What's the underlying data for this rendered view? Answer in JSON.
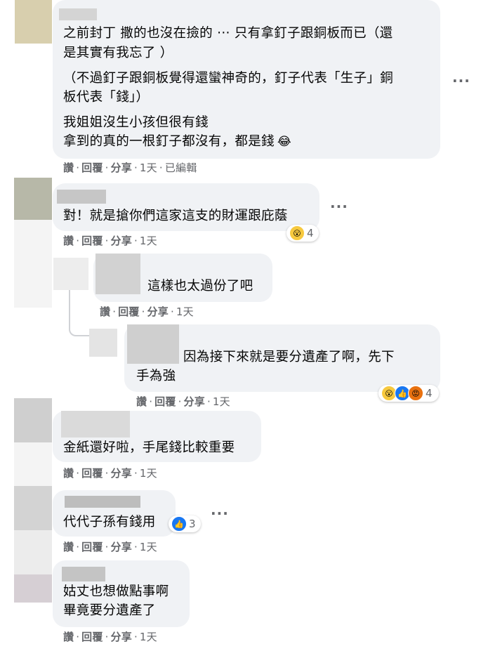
{
  "comments": [
    {
      "lines": [
        "之前封丁 撒的也沒在撿的 ··· 只有拿釘子跟銅板而已（還",
        "是其實有我忘了 ）",
        "（不過釘子跟銅板覺得還蠻神奇的，釘子代表「生子」銅",
        "板代表「錢」）",
        "我姐姐沒生小孩但很有錢",
        "拿到的真的一根釘子都沒有，都是錢"
      ],
      "emoji": "😂",
      "actions": {
        "like": "讚",
        "reply": "回覆",
        "share": "分享",
        "time": "1天",
        "edited": "已編輯"
      }
    },
    {
      "lines": [
        "對！就是搶你們這家這支的財運跟庇蔭"
      ],
      "reaction_count": "4",
      "actions": {
        "like": "讚",
        "reply": "回覆",
        "share": "分享",
        "time": "1天"
      }
    },
    {
      "lines": [
        "這樣也太過份了吧"
      ],
      "actions": {
        "like": "讚",
        "reply": "回覆",
        "share": "分享",
        "time": "1天"
      }
    },
    {
      "lines": [
        "因為接下來就是要分遺產了啊，先下",
        "手為強"
      ],
      "reaction_count": "4",
      "actions": {
        "like": "讚",
        "reply": "回覆",
        "share": "分享",
        "time": "1天"
      }
    },
    {
      "lines": [
        "金紙還好啦，手尾錢比較重要"
      ],
      "actions": {
        "like": "讚",
        "reply": "回覆",
        "share": "分享",
        "time": "1天"
      }
    },
    {
      "lines": [
        "代代子孫有錢用"
      ],
      "reaction_count": "3",
      "actions": {
        "like": "讚",
        "reply": "回覆",
        "share": "分享",
        "time": "1天"
      }
    },
    {
      "lines": [
        "姑丈也想做點事啊",
        "畢竟要分遺產了"
      ],
      "actions": {
        "like": "讚",
        "reply": "回覆",
        "share": "分享",
        "time": "1天"
      }
    }
  ],
  "more_glyph": "···",
  "sep": "·",
  "colors": {
    "bubble": "#f0f2f5",
    "meta": "#65676b",
    "text": "#050505"
  }
}
